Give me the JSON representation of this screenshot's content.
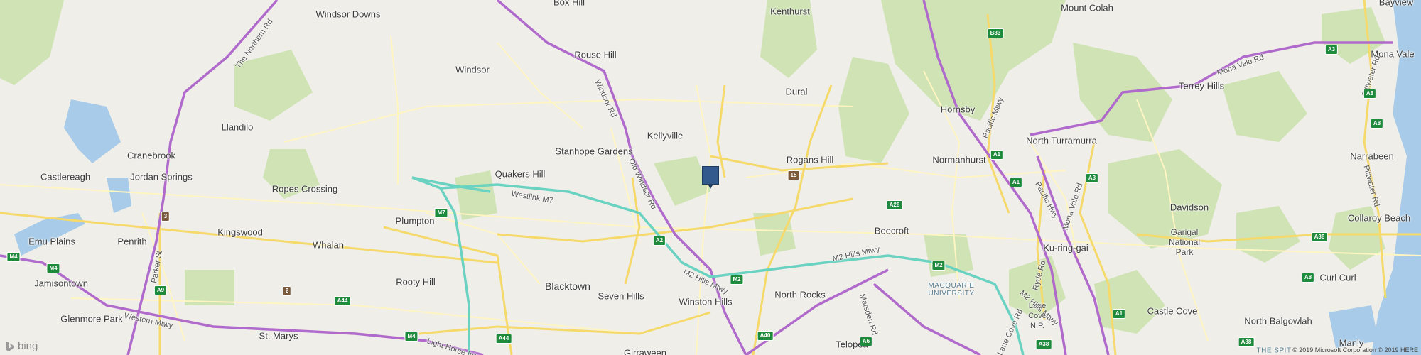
{
  "map": {
    "brand": "bing",
    "copyright": "© 2019 Microsoft Corporation © 2019 HERE",
    "colors": {
      "land": "#efeee9",
      "park": "#cfe3b4",
      "water": "#a7cbe8",
      "motorway": "#b06acb",
      "toll": "#6ad2c1",
      "major": "#f5d96b",
      "minor": "#fff5c2",
      "shield": "#1e8a3c"
    },
    "marker": {
      "label": "location-marker",
      "color": "#335a8c"
    },
    "places": [
      {
        "id": "box-hill",
        "name": "Box Hill"
      },
      {
        "id": "windsor-downs",
        "name": "Windsor Downs"
      },
      {
        "id": "kenthurst",
        "name": "Kenthurst"
      },
      {
        "id": "mount-colah",
        "name": "Mount Colah"
      },
      {
        "id": "bayview",
        "name": "Bayview"
      },
      {
        "id": "rouse-hill",
        "name": "Rouse Hill"
      },
      {
        "id": "windsor",
        "name": "Windsor"
      },
      {
        "id": "dural",
        "name": "Dural"
      },
      {
        "id": "hornsby",
        "name": "Hornsby"
      },
      {
        "id": "mona-vale",
        "name": "Mona Vale"
      },
      {
        "id": "terrey-hills",
        "name": "Terrey Hills"
      },
      {
        "id": "llandilo",
        "name": "Llandilo"
      },
      {
        "id": "kellyville",
        "name": "Kellyville"
      },
      {
        "id": "north-turramurra",
        "name": "North Turramurra"
      },
      {
        "id": "cranebrook",
        "name": "Cranebrook"
      },
      {
        "id": "stanhope-gardens",
        "name": "Stanhope Gardens"
      },
      {
        "id": "rogans-hill",
        "name": "Rogans Hill"
      },
      {
        "id": "normanhurst",
        "name": "Normanhurst"
      },
      {
        "id": "narrabeen",
        "name": "Narrabeen"
      },
      {
        "id": "jordan-springs",
        "name": "Jordan Springs"
      },
      {
        "id": "castlereagh",
        "name": "Castlereagh"
      },
      {
        "id": "quakers-hill",
        "name": "Quakers Hill"
      },
      {
        "id": "ropes-crossing",
        "name": "Ropes Crossing"
      },
      {
        "id": "davidson",
        "name": "Davidson"
      },
      {
        "id": "collaroy-beach",
        "name": "Collaroy Beach"
      },
      {
        "id": "plumpton",
        "name": "Plumpton"
      },
      {
        "id": "kingswood",
        "name": "Kingswood"
      },
      {
        "id": "beecroft",
        "name": "Beecroft"
      },
      {
        "id": "emu-plains",
        "name": "Emu Plains"
      },
      {
        "id": "penrith",
        "name": "Penrith"
      },
      {
        "id": "whalan",
        "name": "Whalan"
      },
      {
        "id": "ku-ring-gai",
        "name": "Ku-ring-gai"
      },
      {
        "id": "jamisontown",
        "name": "Jamisontown"
      },
      {
        "id": "rooty-hill",
        "name": "Rooty Hill"
      },
      {
        "id": "blacktown",
        "name": "Blacktown"
      },
      {
        "id": "curl-curl",
        "name": "Curl Curl"
      },
      {
        "id": "seven-hills",
        "name": "Seven Hills"
      },
      {
        "id": "north-rocks",
        "name": "North Rocks"
      },
      {
        "id": "winston-hills",
        "name": "Winston Hills"
      },
      {
        "id": "glenmore-park",
        "name": "Glenmore Park"
      },
      {
        "id": "castle-cove",
        "name": "Castle Cove"
      },
      {
        "id": "north-balgowlah",
        "name": "North Balgowlah"
      },
      {
        "id": "st-marys",
        "name": "St. Marys"
      },
      {
        "id": "telopea",
        "name": "Telopea"
      },
      {
        "id": "girraween",
        "name": "Girraween"
      },
      {
        "id": "manly",
        "name": "Manly"
      }
    ],
    "areas": [
      {
        "id": "garigal",
        "name": "Garigal National Park"
      },
      {
        "id": "lane-cove",
        "name": "Lane Cove N.P."
      },
      {
        "id": "macquarie",
        "name": "MACQUARIE UNIVERSITY"
      },
      {
        "id": "the-spit",
        "name": "THE SPIT"
      }
    ],
    "roads": [
      {
        "id": "northern-rd",
        "name": "The Northern Rd"
      },
      {
        "id": "windsor-rd",
        "name": "Windsor Rd"
      },
      {
        "id": "old-windsor-rd",
        "name": "Old Windsor Rd"
      },
      {
        "id": "westlink-m7",
        "name": "Westlink M7"
      },
      {
        "id": "m2-hills-1",
        "name": "M2 Hills Mtwy"
      },
      {
        "id": "m2-hills-2",
        "name": "M2 Hills Mtwy"
      },
      {
        "id": "m2-hills-3",
        "name": "M2 Hills Mtwy"
      },
      {
        "id": "western-mtwy",
        "name": "Western Mtwy"
      },
      {
        "id": "light-horse",
        "name": "Light Horse Intc"
      },
      {
        "id": "parker-st",
        "name": "Parker St"
      },
      {
        "id": "pacific-mtwy",
        "name": "Pacific Mtwy"
      },
      {
        "id": "pacific-hwy",
        "name": "Pacific Hwy"
      },
      {
        "id": "mona-vale-rd",
        "name": "Mona Vale Rd"
      },
      {
        "id": "mona-vale-rd-2",
        "name": "Mona Vale Rd"
      },
      {
        "id": "pittwater-rd",
        "name": "Pittwater Rd"
      },
      {
        "id": "pittwater-rd-2",
        "name": "Pittwater Rd"
      },
      {
        "id": "ryde-rd",
        "name": "Ryde Rd"
      },
      {
        "id": "lane-cove-rd",
        "name": "Lane Cove Rd"
      },
      {
        "id": "marsden-rd",
        "name": "Marsden Rd"
      }
    ],
    "shields": [
      {
        "id": "b83",
        "label": "B83"
      },
      {
        "id": "a3-top",
        "label": "A3"
      },
      {
        "id": "a8-top",
        "label": "A8"
      },
      {
        "id": "a1-a",
        "label": "A1"
      },
      {
        "id": "a1-b",
        "label": "A1"
      },
      {
        "id": "a3-mid",
        "label": "A3"
      },
      {
        "id": "a8-mid",
        "label": "A8"
      },
      {
        "id": "m7",
        "label": "M7"
      },
      {
        "id": "a28",
        "label": "A28"
      },
      {
        "id": "a2",
        "label": "A2"
      },
      {
        "id": "m2-a",
        "label": "M2"
      },
      {
        "id": "m2-b",
        "label": "M2"
      },
      {
        "id": "a38-a",
        "label": "A38"
      },
      {
        "id": "a38-b",
        "label": "A38"
      },
      {
        "id": "m4-a",
        "label": "M4"
      },
      {
        "id": "m4-b",
        "label": "M4"
      },
      {
        "id": "a9",
        "label": "A9"
      },
      {
        "id": "a44-a",
        "label": "A44"
      },
      {
        "id": "a44-b",
        "label": "A44"
      },
      {
        "id": "m4-c",
        "label": "M4"
      },
      {
        "id": "a40",
        "label": "A40"
      },
      {
        "id": "a6",
        "label": "A6"
      },
      {
        "id": "a1-c",
        "label": "A1"
      },
      {
        "id": "a8-low",
        "label": "A8"
      },
      {
        "id": "a38-c",
        "label": "A38"
      }
    ],
    "route_markers": [
      {
        "id": "r3",
        "label": "3"
      },
      {
        "id": "r2",
        "label": "2"
      },
      {
        "id": "r15",
        "label": "15"
      }
    ]
  }
}
